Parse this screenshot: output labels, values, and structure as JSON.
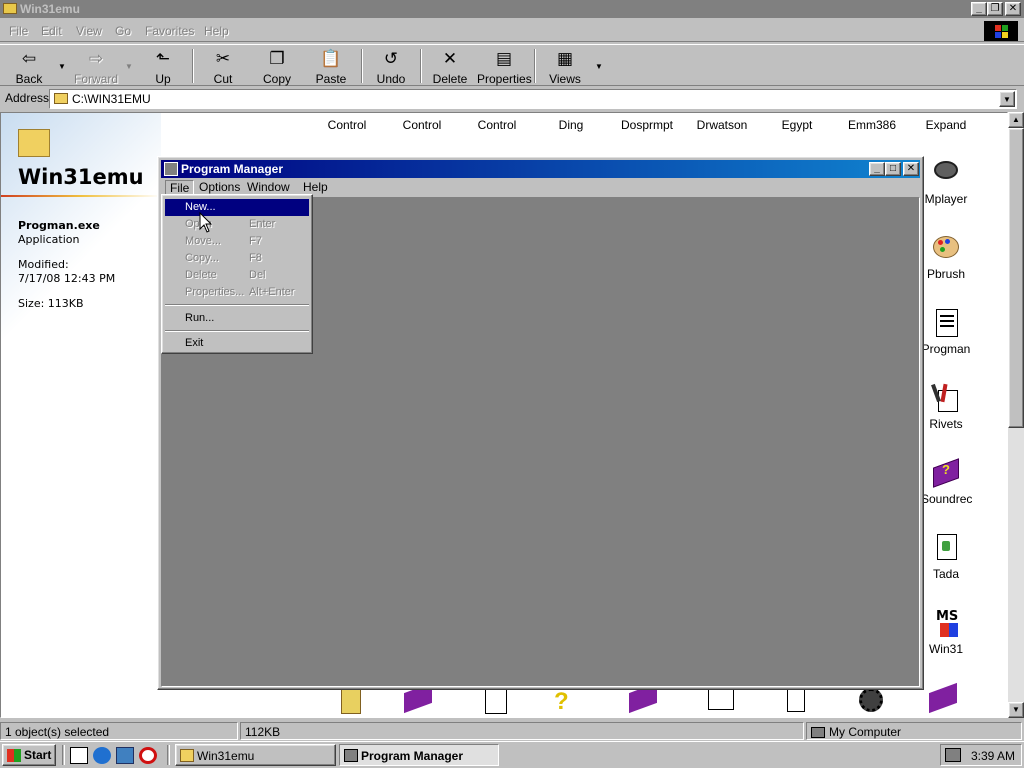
{
  "window": {
    "title": "Win31emu",
    "controls": {
      "minimize": "_",
      "maximize": "❐",
      "close": "✕"
    }
  },
  "menubar": [
    "File",
    "Edit",
    "View",
    "Go",
    "Favorites",
    "Help"
  ],
  "toolbar": {
    "back": "Back",
    "forward": "Forward",
    "up": "Up",
    "cut": "Cut",
    "copy": "Copy",
    "paste": "Paste",
    "undo": "Undo",
    "delete": "Delete",
    "properties": "Properties",
    "views": "Views"
  },
  "address": {
    "label": "Address",
    "value": "C:\\WIN31EMU"
  },
  "webview": {
    "title": "Win31emu",
    "file_name": "Progman.exe",
    "file_type": "Application",
    "modified_label": "Modified:",
    "modified_value": "7/17/08 12:43 PM",
    "size": "Size: 113KB"
  },
  "files_top_row": [
    "Control",
    "Control",
    "Control",
    "Ding",
    "Dosprmpt",
    "Drwatson",
    "Egypt",
    "Emm386",
    "Expand"
  ],
  "files_right_column": [
    "Mplayer",
    "Pbrush",
    "Progman",
    "Rivets",
    "Soundrec",
    "Tada",
    "Win31"
  ],
  "program_manager": {
    "title": "Program Manager",
    "menu": [
      "File",
      "Options",
      "Window",
      "Help"
    ],
    "controls": {
      "minimize": "_",
      "maximize": "□",
      "close": "✕"
    },
    "file_menu": {
      "items": [
        {
          "label": "New...",
          "shortcut": ""
        },
        {
          "label": "Open",
          "shortcut": "Enter"
        },
        {
          "label": "Move...",
          "shortcut": "F7"
        },
        {
          "label": "Copy...",
          "shortcut": "F8"
        },
        {
          "label": "Delete",
          "shortcut": "Del"
        },
        {
          "label": "Properties...",
          "shortcut": "Alt+Enter"
        },
        {
          "label": "Run...",
          "shortcut": ""
        },
        {
          "label": "Exit",
          "shortcut": ""
        }
      ]
    }
  },
  "statusbar": {
    "selection": "1 object(s) selected",
    "size": "112KB",
    "zone": "My Computer"
  },
  "taskbar": {
    "start": "Start",
    "tasks": [
      "Win31emu",
      "Program Manager"
    ],
    "clock": "3:39 AM"
  },
  "colors": {
    "accent": "#000080",
    "title_gradient_end": "#1084d0",
    "desktop_gray": "#c0c0c0",
    "mdi_gray": "#808080"
  }
}
